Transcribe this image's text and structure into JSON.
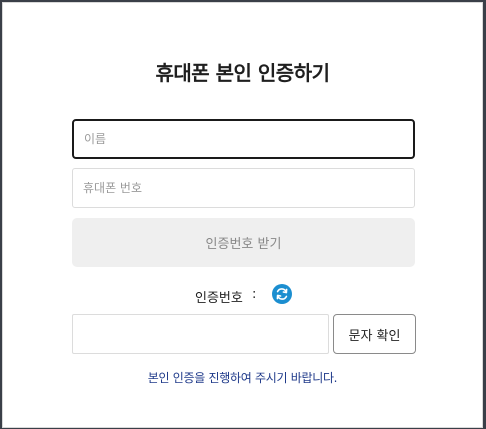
{
  "dialog": {
    "title": "휴대폰 본인 인증하기"
  },
  "form": {
    "name_field": {
      "placeholder": "이름",
      "value": ""
    },
    "phone_field": {
      "placeholder": "휴대폰 번호",
      "value": ""
    },
    "request_button_label": "인증번호 받기",
    "code_label": "인증번호",
    "code_separator": ":",
    "refresh_icon": "refresh-icon",
    "code_field": {
      "placeholder": "",
      "value": ""
    },
    "confirm_button_label": "문자 확인",
    "notice": "본인 인증을 진행하여 주시기 바랍니다."
  },
  "colors": {
    "overlay": "#3a3f48",
    "accent_blue": "#1b8ed0",
    "notice_text": "#1f3a8a",
    "disabled_button_bg": "#efefef"
  }
}
